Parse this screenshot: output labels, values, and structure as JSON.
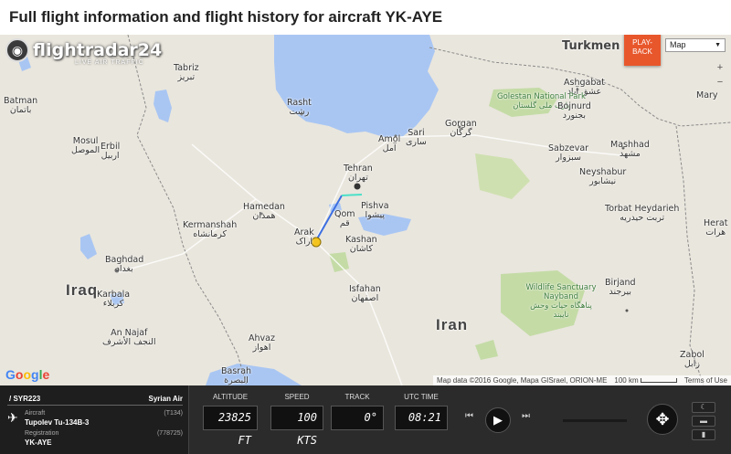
{
  "page": {
    "title": "Full flight information and flight history for aircraft YK-AYE"
  },
  "map": {
    "logo_text": "flightradar24",
    "logo_sub": "LIVE AIR TRAFFIC",
    "playback_label_1": "PLAY-",
    "playback_label_2": "BACK",
    "map_type": "Map",
    "zoom_in": "+",
    "zoom_out": "−",
    "google": "Google",
    "attribution": "Map data ©2016 Google, Mapa GISrael, ORION-ME",
    "scale": "100 km",
    "terms": "Terms of Use",
    "labels": {
      "turkmen": "Turkmen",
      "tabriz": "Tabriz",
      "tabriz_fa": "تبریز",
      "batman": "Batman",
      "batman_ar": "باتمان",
      "rasht": "Rasht",
      "rasht_fa": "رشت",
      "ashgabat": "Ashgabat",
      "ashgabat_ar": "عشق آباد",
      "mary": "Mary",
      "golestan": "Golestan National Park",
      "golestan_fa": "پارک ملی گلستان",
      "bojnurd": "Bojnurd",
      "bojnurd_fa": "بجنورد",
      "gorgan": "Gorgan",
      "gorgan_fa": "گرگان",
      "sari": "Sari",
      "sari_fa": "ساری",
      "amol": "Amol",
      "amol_fa": "آمل",
      "sabzevar": "Sabzevar",
      "sabzevar_fa": "سبزوار",
      "mashhad": "Mashhad",
      "mashhad_fa": "مشهد",
      "mosul": "Mosul",
      "mosul_ar": "الموصل",
      "erbil": "Erbil",
      "erbil_ar": "اربيل",
      "tehran": "Tehran",
      "tehran_fa": "تهران",
      "neyshabur": "Neyshabur",
      "neyshabur_fa": "نیشابور",
      "hamedan": "Hamedan",
      "hamedan_fa": "همدان",
      "pishva": "Pishva",
      "pishva_fa": "پیشوا",
      "qom": "Qom",
      "qom_fa": "قم",
      "torbat": "Torbat Heydarieh",
      "torbat_fa": "تربت حیدریه",
      "kermanshah": "Kermanshah",
      "kermanshah_fa": "کرمانشاه",
      "arak": "Arak",
      "arak_fa": "اراک",
      "kashan": "Kashan",
      "kashan_fa": "کاشان",
      "herat": "Herat",
      "herat_ar": "هرات",
      "baghdad": "Baghdad",
      "baghdad_ar": "بغداد",
      "iraq": "Iraq",
      "karbala": "Karbala",
      "karbala_ar": "كربلاء",
      "isfahan": "Isfahan",
      "isfahan_fa": "اصفهان",
      "birjand": "Birjand",
      "birjand_fa": "بیرجند",
      "nayband": "Wildlife Sanctuary Nayband",
      "nayband_fa": "پناهگاه حیات وحش نایبند",
      "iran": "Iran",
      "najaf": "An Najaf",
      "najaf_ar": "النجف الأشرف",
      "ahvaz": "Ahvaz",
      "ahvaz_fa": "اهواز",
      "zabol": "Zabol",
      "zabol_fa": "زابل",
      "basrah": "Basrah",
      "basrah_ar": "البصرة"
    }
  },
  "panel": {
    "flight": "/ SYR223",
    "airline": "Syrian Air",
    "aircraft_label": "Aircraft",
    "aircraft_value": "Tupolev Tu-134B-3",
    "aircraft_code": "(T134)",
    "registration_label": "Registration",
    "registration_value": "YK-AYE",
    "registration_code": "(778725)"
  },
  "gauges": {
    "altitude_label": "ALTITUDE",
    "altitude_value": "23825 FT",
    "speed_label": "SPEED",
    "speed_value": "100 KTS",
    "track_label": "TRACK",
    "track_value": "0°",
    "utc_label": "UTC TIME",
    "utc_value": "08:21"
  },
  "controls": {
    "rewind": "⏮",
    "play": "▶",
    "forward": "⏭",
    "center": "✥"
  },
  "colors": {
    "water": "#a9c6f3",
    "land": "#e9e6dd",
    "park": "#c4dba6",
    "accent": "#e8572c",
    "track": "#3d6fe2"
  }
}
